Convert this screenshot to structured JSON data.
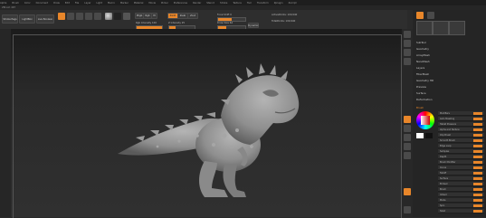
{
  "menu": {
    "items": [
      "Alpha",
      "Brush",
      "Color",
      "Document",
      "Draw",
      "Edit",
      "File",
      "Layer",
      "Light",
      "Macro",
      "Marker",
      "Material",
      "Movie",
      "Picker",
      "Preferences",
      "Render",
      "Stencil",
      "Stroke",
      "Texture",
      "Tool",
      "Transform",
      "Zplugin",
      "Zscript"
    ]
  },
  "title": "ZBrush 4R7",
  "toolbar": {
    "projection_master": "Stroke Pegs",
    "lightbox": "LightBox",
    "live_boolean": "Live Boolean",
    "mrgb": "Mrgb",
    "rgb": "Rgb",
    "m": "M",
    "zadd": "Zadd",
    "zsub": "Zsub",
    "zcut": "Zcut",
    "rgb_intensity": "Rgb Intensity 100",
    "z_intensity": "Z Intensity 25",
    "focal_shift": "Focal Shift 0",
    "draw_size": "Draw Size 64",
    "dynamic": "Dynamic",
    "active_points": "ActivePoints: 100,940",
    "total_points": "TotalPoints: 100,940"
  },
  "palette": {
    "header_items": [
      "SpotLight",
      "Lightbox",
      "Subtool"
    ],
    "tool_labels": [
      "Load Tool",
      "Save As",
      "Copy Tool",
      "Paste Tool",
      "Import",
      "Export",
      "Clone",
      "Make PolyMesh3D",
      "GoZ",
      "All",
      "Visible"
    ],
    "sections": [
      "SubTool",
      "Geometry",
      "ArrayMesh",
      "NanoMesh",
      "Layers",
      "FiberMesh",
      "Geometry HD",
      "Preview",
      "Surface",
      "Deformation"
    ],
    "brush_section": "Brush",
    "brush_rows": [
      "Modifiers",
      "Auto Masking",
      "Tablet Pressure",
      "Alpha and Texture",
      "Clip Brush",
      "Smooth Brush",
      "Edge Loop",
      "Samples",
      "Depth",
      "Brush Modifier",
      "Curve",
      "Falloff",
      "Surface",
      "Embed",
      "Brush",
      "Imbed",
      "Mode",
      "Spin",
      "Twist"
    ]
  },
  "colors": {
    "accent": "#e8862a",
    "background": "#2a2a2a",
    "viewport_top": "#1b1b1b",
    "model": "#8f8f8f"
  },
  "icons": [
    "sculptris-pro-icon",
    "move-icon",
    "scale-icon",
    "rotate-icon",
    "draw-icon",
    "edit-icon",
    "color-picker-icon",
    "material-sphere-icon",
    "alpha-icon",
    "texture-icon"
  ]
}
